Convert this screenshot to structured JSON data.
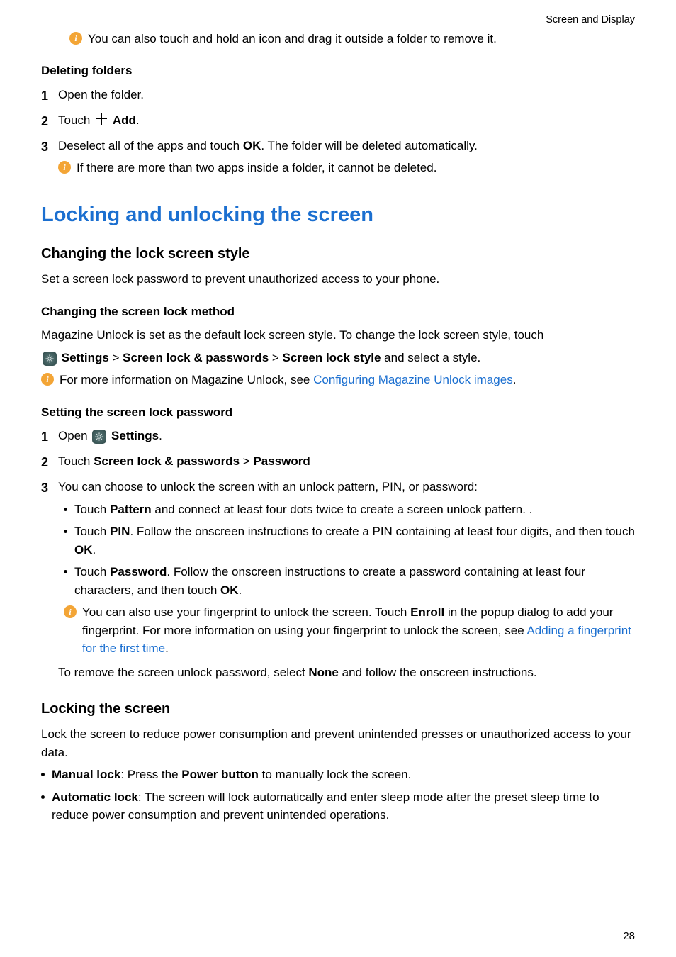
{
  "header": {
    "breadcrumb": "Screen and Display"
  },
  "page_number": "28",
  "topnote": "You can also touch and hold an icon and drag it outside a folder to remove it.",
  "deleting": {
    "title": "Deleting folders",
    "steps": [
      {
        "num": "1",
        "body": "Open the folder."
      },
      {
        "num": "2",
        "prefix": "Touch ",
        "bold": "Add",
        "suffix": "."
      },
      {
        "num": "3",
        "prefix": "Deselect all of the apps and touch ",
        "bold": "OK",
        "suffix": ". The folder will be deleted automatically."
      }
    ],
    "note": "If there are more than two apps inside a folder, it cannot be deleted."
  },
  "locking": {
    "title": "Locking and unlocking the screen",
    "change_style": {
      "title": "Changing the lock screen style",
      "intro": "Set a screen lock password to prevent unauthorized access to your phone."
    },
    "change_method": {
      "title": "Changing the screen lock method",
      "line1": "Magazine Unlock is set as the default lock screen style. To change the lock screen style, touch",
      "settings_label": "Settings",
      "path_sep": " > ",
      "path2": "Screen lock & passwords",
      "path3": "Screen lock style",
      "tail": " and select a style.",
      "note_prefix": "For more information on Magazine Unlock, see ",
      "note_link": "Configuring Magazine Unlock images",
      "note_suffix": "."
    },
    "setpw": {
      "title": "Setting the screen lock password",
      "step1_prefix": "Open ",
      "step1_bold": "Settings",
      "step1_suffix": ".",
      "step2_prefix": "Touch ",
      "step2_bold1": "Screen lock & passwords",
      "step2_sep": " > ",
      "step2_bold2": "Password",
      "step3": "You can choose to unlock the screen with an unlock pattern, PIN, or password:",
      "bullets": [
        {
          "pre": "Touch ",
          "b": "Pattern",
          "post": " and connect at least four dots twice to create a screen unlock pattern. ."
        },
        {
          "pre": "Touch ",
          "b": "PIN",
          "post": ". Follow the onscreen instructions to create a PIN containing at least four digits, and then touch ",
          "b2": "OK",
          "post2": "."
        },
        {
          "pre": "Touch ",
          "b": "Password",
          "post": ". Follow the onscreen instructions to create a password containing at least four characters, and then touch ",
          "b2": "OK",
          "post2": "."
        }
      ],
      "tip_pre": "You can also use your fingerprint to unlock the screen. Touch ",
      "tip_b": "Enroll",
      "tip_mid": " in the popup dialog to add your fingerprint. For more information on using your fingerprint to unlock the screen, see ",
      "tip_link": "Adding a fingerprint for the first time",
      "tip_suf": ".",
      "remove_pre": "To remove the screen unlock password, select ",
      "remove_b": "None",
      "remove_post": " and follow the onscreen instructions."
    },
    "lockscreen": {
      "title": "Locking the screen",
      "intro": "Lock the screen to reduce power consumption and prevent unintended presses or unauthorized access to your data.",
      "bullets": [
        {
          "b": "Manual lock",
          "mid": ": Press the ",
          "b2": "Power button",
          "post": " to manually lock the screen."
        },
        {
          "b": "Automatic lock",
          "post": ": The screen will lock automatically and enter sleep mode after the preset sleep time to reduce power consumption and prevent unintended operations."
        }
      ]
    }
  }
}
